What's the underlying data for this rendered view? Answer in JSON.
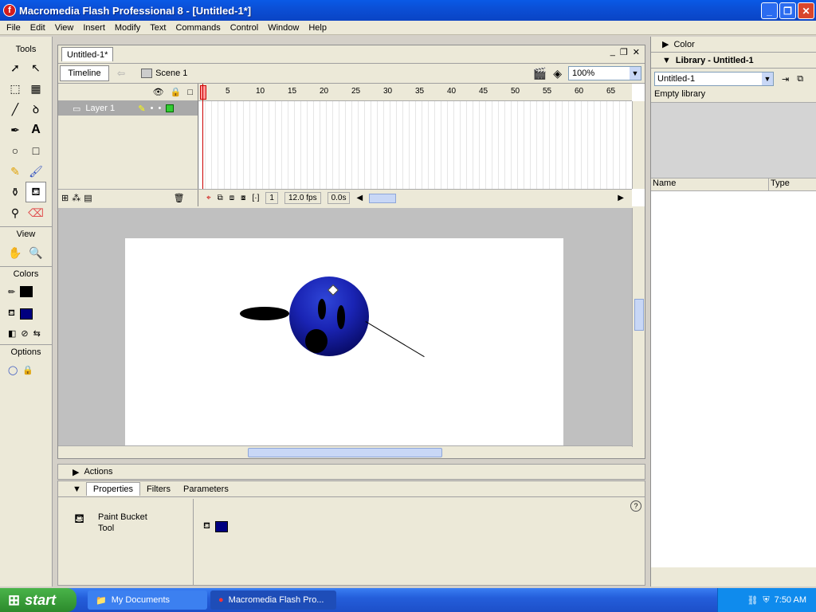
{
  "window": {
    "title": "Macromedia Flash Professional 8 - [Untitled-1*]",
    "app_icon_letter": "f",
    "minimize": "_",
    "restore": "❐",
    "close": "✕"
  },
  "menu": [
    "File",
    "Edit",
    "View",
    "Insert",
    "Modify",
    "Text",
    "Commands",
    "Control",
    "Window",
    "Help"
  ],
  "tools": {
    "header": "Tools",
    "view_label": "View",
    "colors_label": "Colors",
    "options_label": "Options",
    "stroke_color": "#000000",
    "fill_color": "#000080"
  },
  "document": {
    "tab": "Untitled-1*",
    "timeline_button": "Timeline",
    "scene": "Scene 1",
    "zoom": "100%"
  },
  "timeline": {
    "ruler": [
      "1",
      "5",
      "10",
      "15",
      "20",
      "25",
      "30",
      "35",
      "40",
      "45",
      "50",
      "55",
      "60",
      "65"
    ],
    "layer_name": "Layer 1",
    "current_frame": "1",
    "fps": "12.0 fps",
    "time": "0.0s"
  },
  "panels": {
    "actions": "Actions",
    "props_tabs": [
      "Properties",
      "Filters",
      "Parameters"
    ],
    "tool_name_line1": "Paint Bucket",
    "tool_name_line2": "Tool",
    "help": "?"
  },
  "right": {
    "color": "Color",
    "library": "Library - Untitled-1",
    "library_select": "Untitled-1",
    "empty": "Empty library",
    "col_name": "Name",
    "col_type": "Type"
  },
  "taskbar": {
    "start": "start",
    "task1": "My Documents",
    "task2": "Macromedia Flash Pro...",
    "time": "7:50 AM"
  }
}
